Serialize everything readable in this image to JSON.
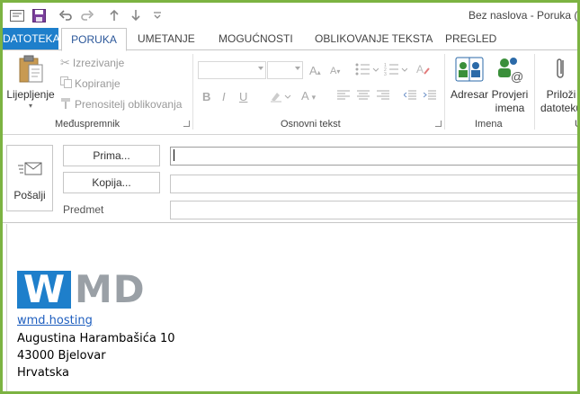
{
  "window": {
    "title": "Bez naslova - Poruka (H"
  },
  "tabs": {
    "file": "DATOTEKA",
    "items": [
      "PORUKA",
      "UMETANJE",
      "MOGUĆNOSTI",
      "OBLIKOVANJE TEKSTA",
      "PREGLED"
    ]
  },
  "ribbon": {
    "clipboard": {
      "label": "Međuspremnik",
      "paste": "Lijepljenje",
      "cut": "Izrezivanje",
      "copy": "Kopiranje",
      "format_painter": "Prenositelj oblikovanja"
    },
    "basic_text": {
      "label": "Osnovni tekst"
    },
    "names": {
      "label": "Imena",
      "address_book": "Adresar",
      "check_names_line1": "Provjeri",
      "check_names_line2": "imena"
    },
    "include": {
      "attach_line1": "Priloži",
      "attach_line2": "datoteku",
      "label": "U"
    }
  },
  "compose": {
    "send": "Pošalji",
    "to_button": "Prima...",
    "cc_button": "Kopija...",
    "subject_label": "Predmet",
    "to_value": "",
    "cc_value": "",
    "subject_value": ""
  },
  "signature": {
    "logo_w": "W",
    "logo_md": "MD",
    "link": "wmd.hosting",
    "street": "Augustina Harambašića 10",
    "city": "43000 Bjelovar",
    "country": "Hrvatska"
  },
  "colors": {
    "frame": "#7cb342",
    "file_tab": "#1e7fcb",
    "active_tab_text": "#2b579a",
    "logo_blue": "#1e7fcb",
    "logo_grey": "#9aa0a6",
    "link": "#1f5fbf"
  }
}
